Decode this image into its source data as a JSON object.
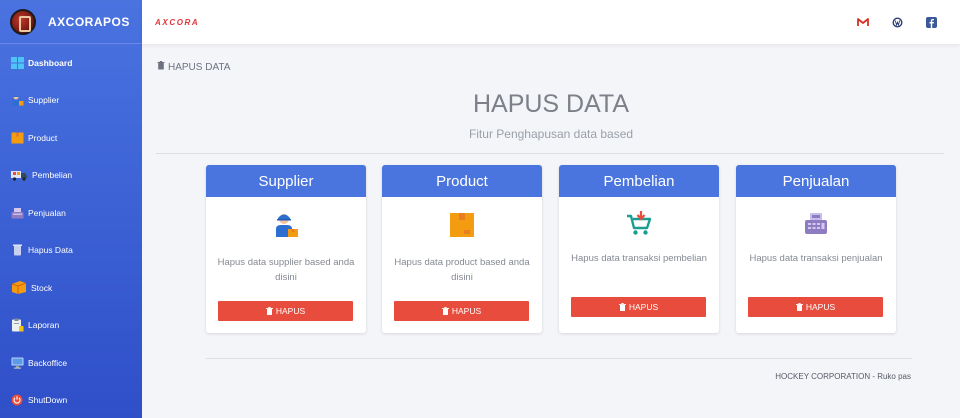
{
  "sidebar": {
    "brand": "AXCORAPOS",
    "items": [
      {
        "label": "Dashboard",
        "icon": "windows-icon"
      },
      {
        "label": "Supplier",
        "icon": "supplier-icon"
      },
      {
        "label": "Product",
        "icon": "box-icon"
      },
      {
        "label": "Pembelian",
        "icon": "truck-icon"
      },
      {
        "label": "Penjualan",
        "icon": "register-icon"
      },
      {
        "label": "Hapus Data",
        "icon": "trash-icon"
      },
      {
        "label": "Stock",
        "icon": "stock-box-icon"
      },
      {
        "label": "Laporan",
        "icon": "clipboard-icon"
      },
      {
        "label": "Backoffice",
        "icon": "monitor-icon"
      },
      {
        "label": "ShutDown",
        "icon": "power-icon"
      }
    ]
  },
  "topbar": {
    "logo": "AXCORA",
    "icons": [
      "gmail-icon",
      "wordpress-icon",
      "facebook-icon"
    ]
  },
  "main": {
    "breadcrumb": "HAPUS DATA",
    "title": "HAPUS DATA",
    "subtitle": "Fitur Penghapusan data based",
    "cards": [
      {
        "title": "Supplier",
        "text": "Hapus data supplier based anda disini",
        "button": "HAPUS"
      },
      {
        "title": "Product",
        "text": "Hapus data product based anda disini",
        "button": "HAPUS"
      },
      {
        "title": "Pembelian",
        "text": "Hapus data transaksi pembelian",
        "button": "HAPUS"
      },
      {
        "title": "Penjualan",
        "text": "Hapus data transaksi penjualan",
        "button": "HAPUS"
      }
    ],
    "footer": "HOCKEY CORPORATION - Ruko pas"
  },
  "colors": {
    "sidebar_top": "#4a73e0",
    "sidebar_bottom": "#2f4fc8",
    "card_header": "#4a74de",
    "danger": "#e74c3c",
    "brand_red": "#e0353a"
  }
}
